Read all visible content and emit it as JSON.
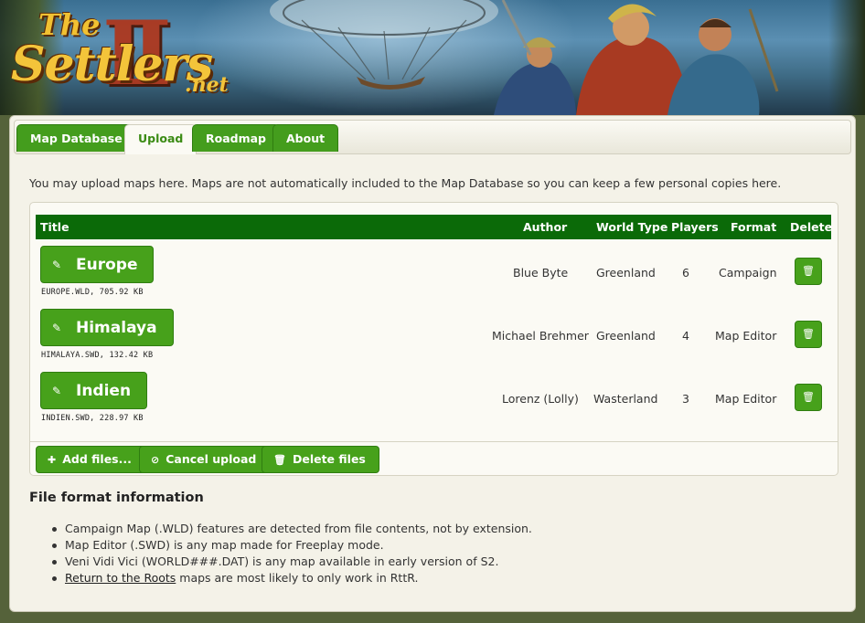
{
  "banner": {
    "logo_the": "The",
    "logo_settlers": "Settlers",
    "logo_roman": "II",
    "logo_net": ".net"
  },
  "tabs": [
    {
      "label": "Map Database",
      "active": false
    },
    {
      "label": "Upload",
      "active": true
    },
    {
      "label": "Roadmap",
      "active": false
    },
    {
      "label": "About",
      "active": false
    }
  ],
  "intro": "You may upload maps here. Maps are not automatically included to the Map Database so you can keep a few personal copies here.",
  "table": {
    "headers": {
      "title": "Title",
      "author": "Author",
      "world_type": "World Type",
      "players": "Players",
      "format": "Format",
      "delete": "Delete"
    },
    "rows": [
      {
        "title": "Europe",
        "file": "EUROPE.WLD, 705.92 KB",
        "author": "Blue Byte",
        "world_type": "Greenland",
        "players": "6",
        "format": "Campaign"
      },
      {
        "title": "Himalaya",
        "file": "HIMALAYA.SWD, 132.42 KB",
        "author": "Michael Brehmer",
        "world_type": "Greenland",
        "players": "4",
        "format": "Map Editor"
      },
      {
        "title": "Indien",
        "file": "INDIEN.SWD, 228.97 KB",
        "author": "Lorenz (Lolly)",
        "world_type": "Wasterland",
        "players": "3",
        "format": "Map Editor"
      }
    ]
  },
  "actions": {
    "add": "Add files...",
    "cancel": "Cancel upload",
    "delete": "Delete files"
  },
  "file_info": {
    "heading": "File format information",
    "items": [
      "Campaign Map (.WLD) features are detected from file contents, not by extension.",
      "Map Editor (.SWD) is any map made for Freeplay mode.",
      "Veni Vidi Vici (WORLD###.DAT) is any map available in early version of S2."
    ],
    "rttr_link": "Return to the Roots",
    "rttr_rest": " maps are most likely to only work in RttR."
  },
  "icons": {
    "edit": "pencil-icon",
    "delete": "trash-icon",
    "add": "plus-icon",
    "cancel": "ban-icon"
  },
  "colors": {
    "accent_green": "#47a11b",
    "header_green": "#0b6a08",
    "panel_bg": "#f4f2e8"
  }
}
